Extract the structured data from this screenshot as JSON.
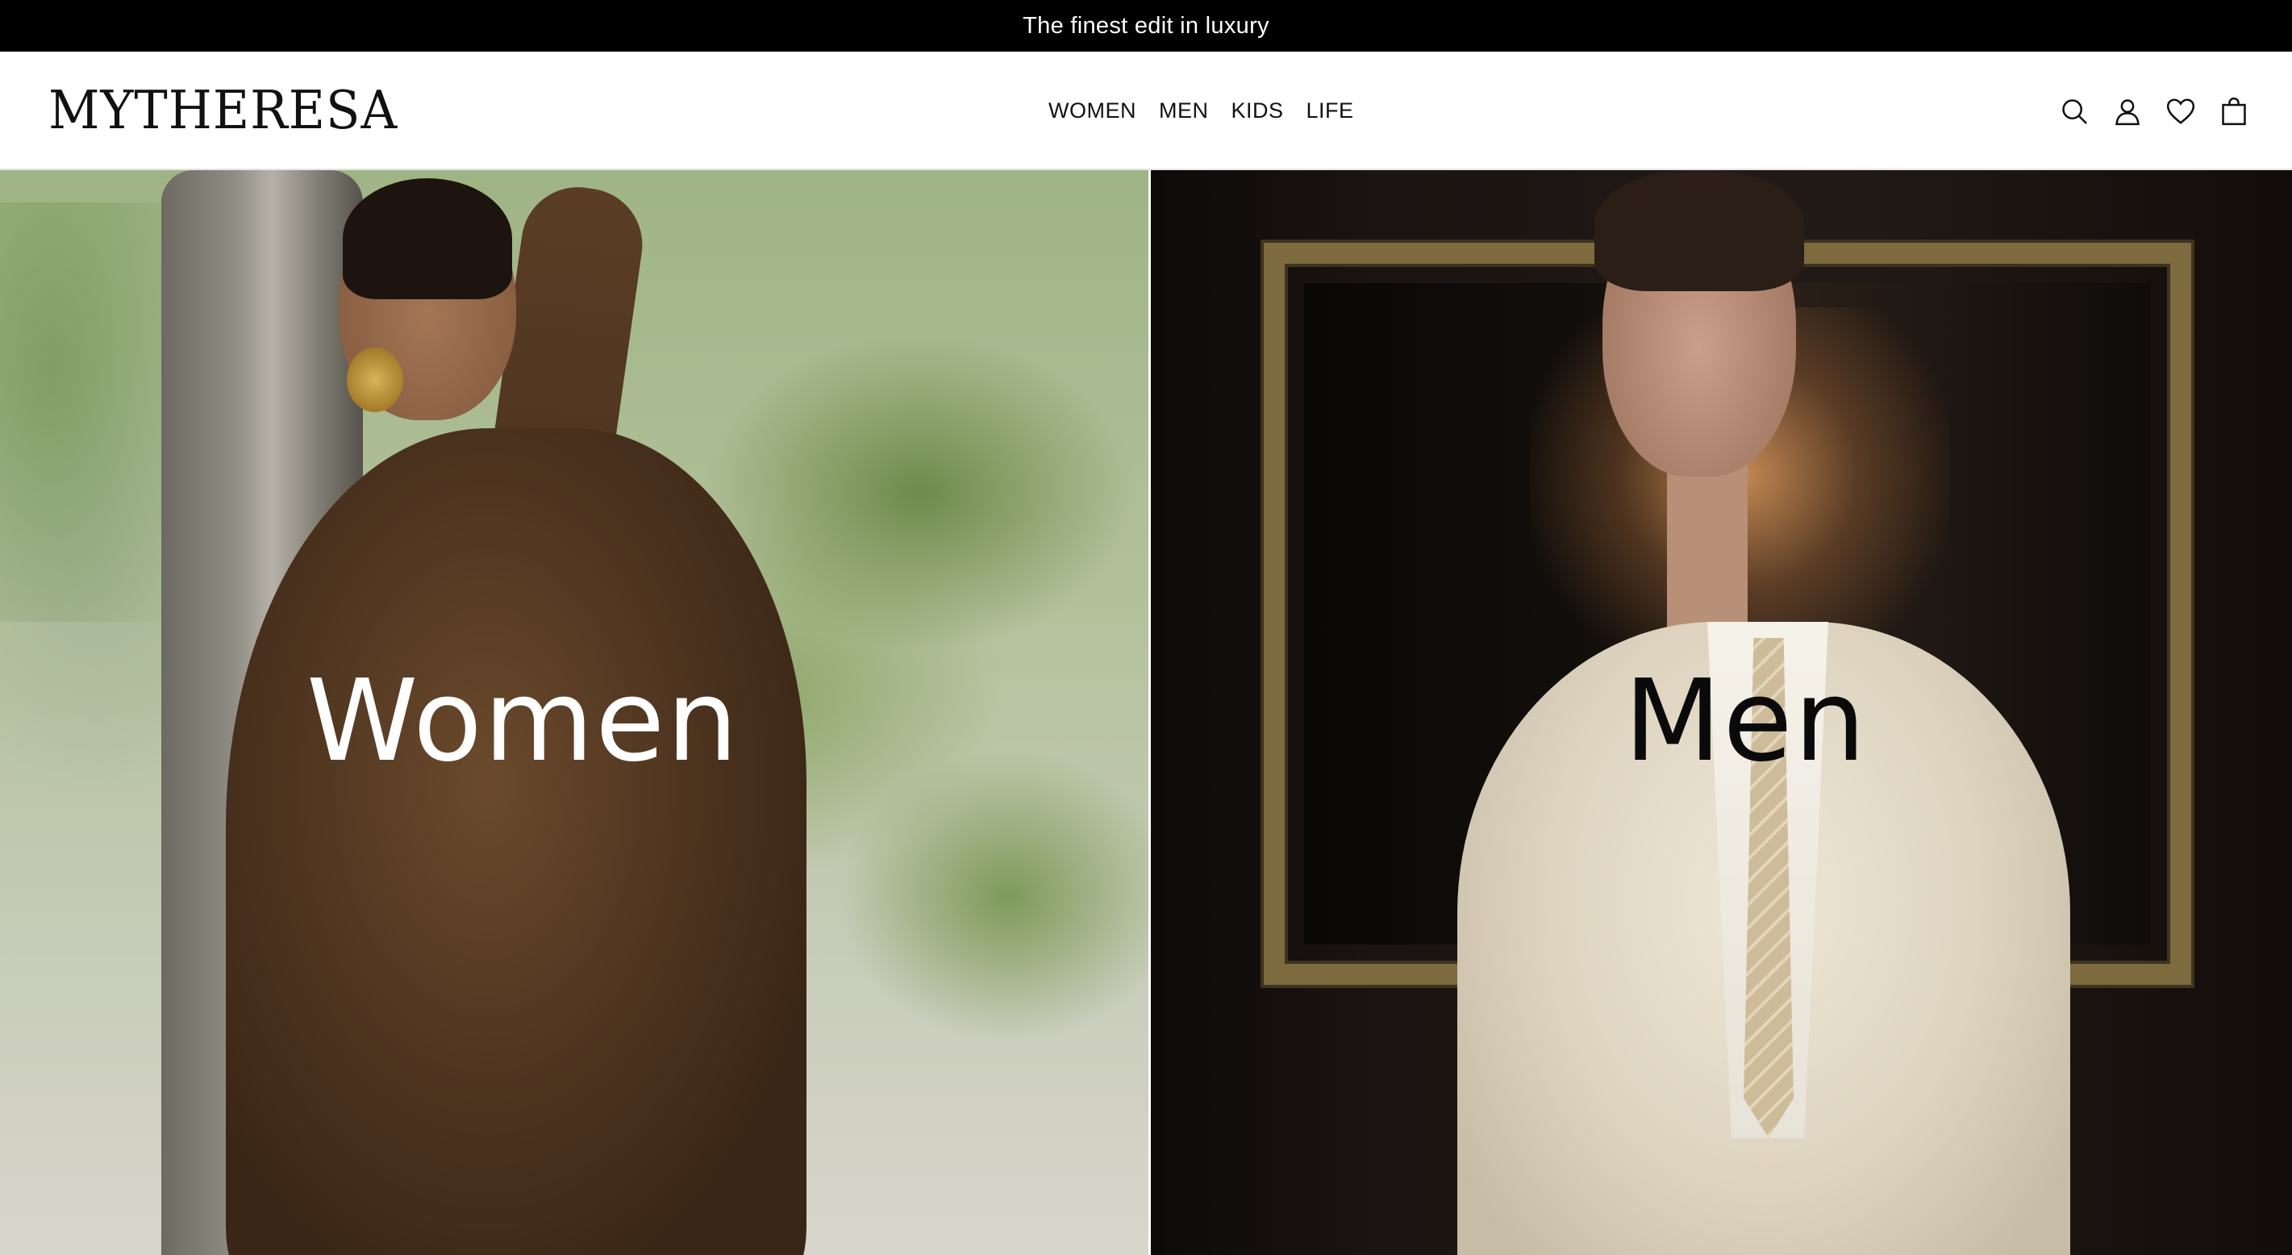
{
  "announcement": {
    "text": "The finest edit in luxury"
  },
  "header": {
    "logo": "MYTHERESA",
    "nav": [
      {
        "label": "WOMEN"
      },
      {
        "label": "MEN"
      },
      {
        "label": "KIDS"
      },
      {
        "label": "LIFE"
      }
    ],
    "icons": [
      "search-icon",
      "account-icon",
      "wishlist-heart-icon",
      "shopping-bag-icon"
    ]
  },
  "hero": {
    "women": {
      "label": "Women"
    },
    "men": {
      "label": "Men"
    }
  },
  "colors": {
    "announcement_bg": "#000000",
    "announcement_text": "#ffffff",
    "header_bg": "#ffffff",
    "text": "#111111"
  }
}
